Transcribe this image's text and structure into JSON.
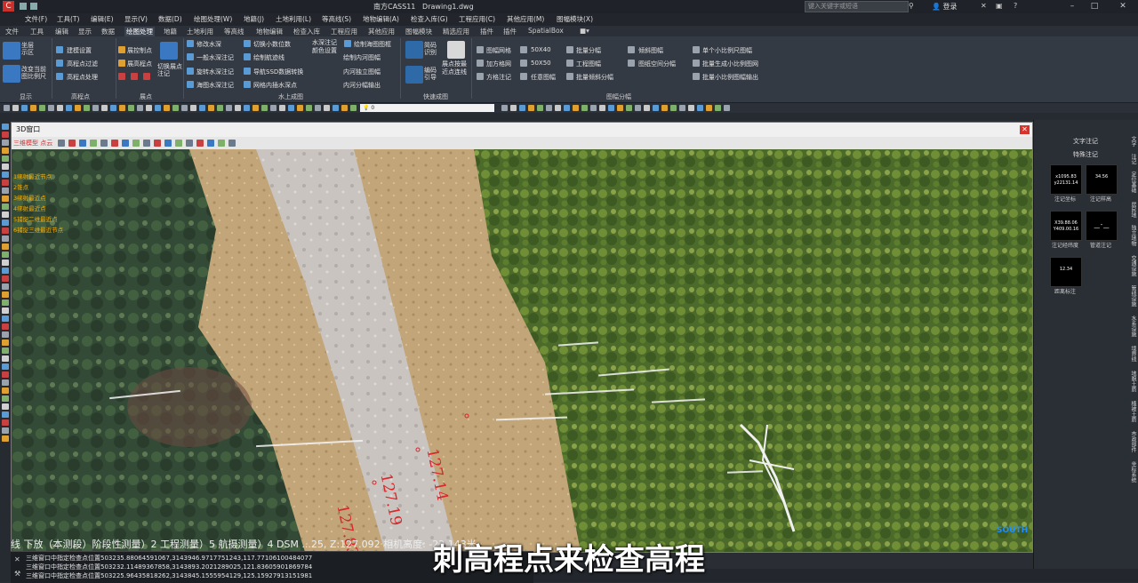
{
  "titlebar": {
    "app_title": "南方CASS11",
    "doc_title": "Drawing1.dwg",
    "search_placeholder": "键入关键字或短语",
    "login": "登录"
  },
  "menus": [
    "文件(F)",
    "工具(T)",
    "编辑(E)",
    "显示(V)",
    "数据(D)",
    "绘图处理(W)",
    "地籍(J)",
    "土地利用(L)",
    "等高线(S)",
    "地物编辑(A)",
    "检查入库(G)",
    "工程应用(C)",
    "其他应用(M)",
    "图幅模块(X)"
  ],
  "tabs": [
    "文件",
    "工具",
    "编辑",
    "显示",
    "数据",
    "绘图处理",
    "地籍",
    "土地利用",
    "等高线",
    "地物编辑",
    "检查入库",
    "工程应用",
    "其他应用",
    "图幅模块",
    "精选应用",
    "插件",
    "插件",
    "SpatialBox"
  ],
  "active_tab": "绘图处理",
  "ribbon": {
    "display": {
      "title": "显示",
      "btn1": "坐层示区",
      "btn2": "改变当前图比例尺"
    },
    "elevation": {
      "title": "高程点",
      "items": [
        "建模设置",
        "高程点过滤",
        "高程点处理"
      ]
    },
    "points": {
      "title": "展点",
      "items": [
        "展控制点",
        "展高程点",
        "切换展点注记"
      ],
      "big": "切换展点注记"
    },
    "hydro": {
      "title": "水上成图",
      "items": [
        "修改水深",
        "一般水深注记",
        "旋转水深注记",
        "海图水深注记",
        "切换小数位数",
        "绘制航迹线",
        "导航SSD数据转换",
        "网格内插水深点",
        "水深注记颜色设置",
        "绘制海图图框",
        "绘制内河图幅",
        "内河独立图幅",
        "内河分幅输出"
      ]
    },
    "quick": {
      "title": "快速成图",
      "items": [
        "简码识别",
        "编码引导",
        "展点按最近点连线"
      ]
    },
    "sheets": {
      "title": "图幅分幅",
      "items": [
        "图幅网格",
        "加方格网",
        "方格注记",
        "50X40",
        "50X50",
        "任意图幅",
        "批量分幅",
        "工程图幅",
        "批量倾斜分幅",
        "倾斜图幅",
        "图纸空间分幅",
        "单个小比例尺图幅",
        "批量生成小比例图网",
        "批量小比例图幅输出"
      ]
    }
  },
  "layer_box": "0",
  "win3d": {
    "title": "3D窗口",
    "toolbar_label": "三维模型 点云",
    "side_menu": [
      "1绑射最近节点",
      "2锥点",
      "3绑射最近点",
      "4绑射最近点",
      "5捕捉二维最近点",
      "6捕捉三维最近节点"
    ],
    "elevations": [
      "127.14",
      "127.19",
      "127.83"
    ],
    "status": "线  下放（本测段）阶段性测量）2 工程测量）5 航摄测量）4 DSM  ...25, Z:127.092    相机高度: -22.143米",
    "watermark": "SOUTH"
  },
  "right_palette": {
    "header1": "文字注记",
    "header2": "特殊注记",
    "tiles": [
      {
        "line1": "x1095.83",
        "line2": "y22131.14",
        "label": "注记坐标"
      },
      {
        "line1": "34.56",
        "line2": "",
        "label": "注记样高"
      },
      {
        "line1": "X39.88.06",
        "line2": "Y409.00.16",
        "label": "注记经纬度"
      },
      {
        "line1": "",
        "line2": "",
        "label": "管道注记"
      },
      {
        "line1": "12.34",
        "line2": "",
        "label": "距离标注"
      }
    ],
    "vertical_labels": [
      "文字",
      "注记",
      "定位基础",
      "居民地",
      "独立地物",
      "交通设施",
      "管线设施",
      "水系设施",
      "境界线",
      "地貌土质",
      "植被土质",
      "市政部件",
      "坐标系统"
    ]
  },
  "command": {
    "lines": [
      "三维窗口中指定检查点位置503235.88064591067,3143946.9717751243,117.77106100484077",
      "三维窗口中指定检查点位置503232.11489367858,3143893.2021289025,121.83605901869784",
      "三维窗口中指定检查点位置503225.96435818262,3143845.1555954129,125.15927913151981"
    ]
  },
  "subtitle": "刺高程点来检查高程"
}
